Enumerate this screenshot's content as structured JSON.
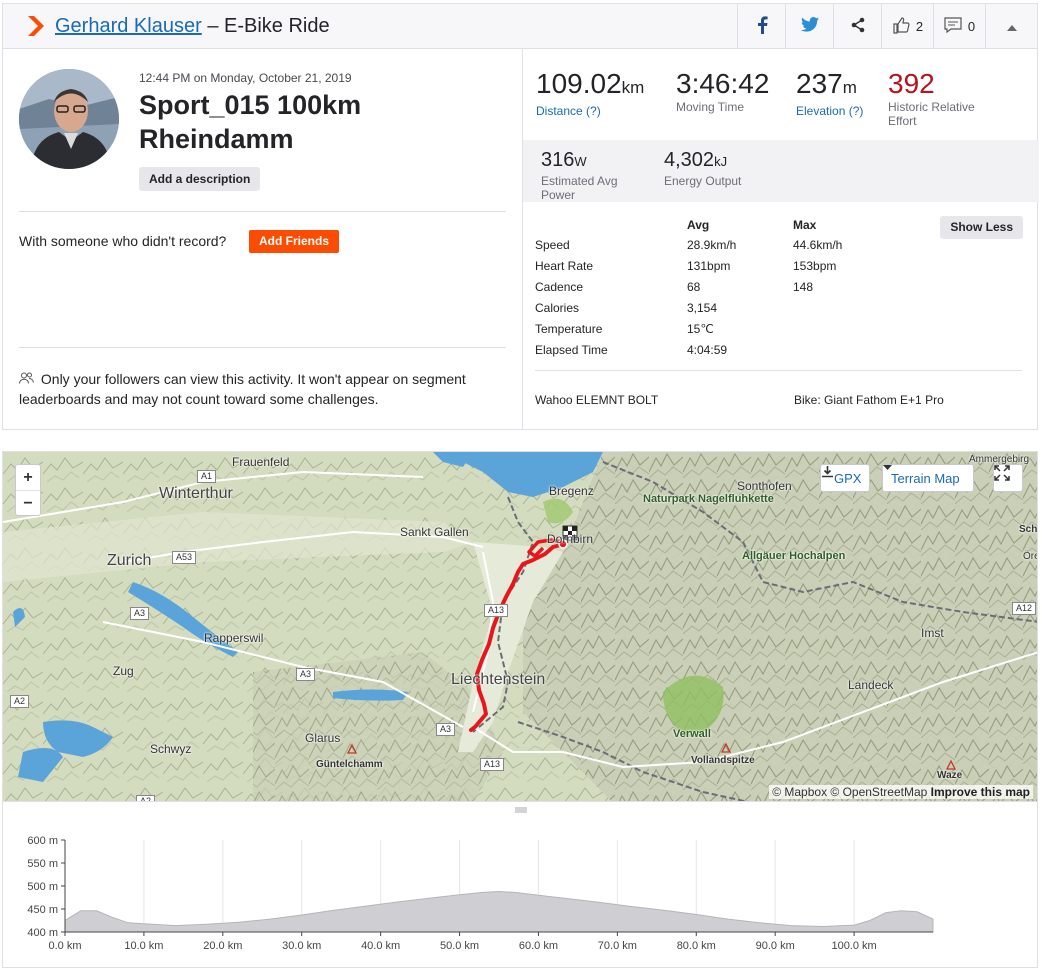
{
  "header": {
    "athlete_name": "Gerhard Klauser",
    "activity_type": "– E-Bike Ride",
    "kudos_count": "2",
    "comments_count": "0",
    "icons": [
      "strava-chevron-icon",
      "facebook-icon",
      "twitter-icon",
      "share-icon",
      "thumbs-up-icon",
      "comment-icon",
      "collapse-caret-icon"
    ]
  },
  "activity": {
    "timestamp": "12:44 PM on Monday, October 21, 2019",
    "name": "Sport_015 100km Rheindamm",
    "add_description": "Add a description",
    "with_someone": "With someone who didn't record?",
    "add_friends": "Add Friends",
    "privacy_text": "Only your followers can view this activity. It won't appear on segment leaderboards and may not count toward some challenges."
  },
  "stats": {
    "distance": {
      "value": "109.02",
      "unit": "km",
      "label": "Distance (?)"
    },
    "moving_time": {
      "value": "3:46:42",
      "label": "Moving Time"
    },
    "elevation": {
      "value": "237",
      "unit": "m",
      "label": "Elevation (?)"
    },
    "relative_effort": {
      "value": "392",
      "label": "Historic Relative Effort"
    },
    "power": {
      "value": "316",
      "unit": "W",
      "label": "Estimated Avg Power"
    },
    "energy": {
      "value": "4,302",
      "unit": "kJ",
      "label": "Energy Output"
    }
  },
  "metrics": {
    "col_avg": "Avg",
    "col_max": "Max",
    "show_less": "Show Less",
    "rows": [
      {
        "label": "Speed",
        "avg": "28.9km/h",
        "max": "44.6km/h"
      },
      {
        "label": "Heart Rate",
        "avg": "131bpm",
        "max": "153bpm"
      },
      {
        "label": "Cadence",
        "avg": "68",
        "max": "148"
      },
      {
        "label": "Calories",
        "avg": "3,154",
        "max": ""
      },
      {
        "label": "Temperature",
        "avg": "15℃",
        "max": ""
      },
      {
        "label": "Elapsed Time",
        "avg": "4:04:59",
        "max": ""
      }
    ],
    "device": "Wahoo ELEMNT BOLT",
    "bike": "Bike: Giant Fathom E+1 Pro"
  },
  "map": {
    "zoom_in": "+",
    "zoom_out": "−",
    "gpx": "GPX",
    "map_type": "Terrain Map",
    "attribution_prefix": "© Mapbox © OpenStreetMap",
    "attribution_link": "Improve this map",
    "labels": {
      "frauenfeld": "Frauenfeld",
      "winterthur": "Winterthur",
      "zurich": "Zurich",
      "rapperswil": "Rapperswil",
      "zug": "Zug",
      "schwyz": "Schwyz",
      "glarus": "Glarus",
      "guntelchamm": "Güntelchamm",
      "sankt_gallen": "Sankt Gallen",
      "bregenz": "Bregenz",
      "dornbirn": "Dornbirn",
      "liechtenstein": "Liechtenstein",
      "sonthofen": "Sonthofen",
      "nagelfluhkette": "Naturpark Nagelfluhkette",
      "hochalpen": "Allgäuer Hochalpen",
      "imst": "Imst",
      "landeck": "Landeck",
      "verwall": "Verwall",
      "vollandspitze": "Vollandspitze",
      "waze": "Waze",
      "ammergebirge": "Ammergebirg",
      "sch": "Sch",
      "oro": "Öre"
    },
    "shields": {
      "a1": "A1",
      "a53": "A53",
      "a3a": "A3",
      "a3b": "A3",
      "a2": "A2",
      "a13a": "A13",
      "a13b": "A13",
      "a3c": "A3",
      "a12": "A12",
      "a2b": "A2"
    },
    "colors": {
      "route": "#e8161c",
      "water": "#5aa4d9",
      "terrain": "#cfd8b8"
    }
  },
  "chart_data": {
    "type": "area",
    "title": "",
    "xlabel": "",
    "ylabel": "",
    "ylim": [
      400,
      600
    ],
    "xlim": [
      0,
      110
    ],
    "y_ticks": [
      "600 m",
      "550 m",
      "500 m",
      "450 m",
      "400 m"
    ],
    "x_ticks": [
      "0.0 km",
      "10.0 km",
      "20.0 km",
      "30.0 km",
      "40.0 km",
      "50.0 km",
      "60.0 km",
      "70.0 km",
      "80.0 km",
      "90.0 km",
      "100.0 km"
    ],
    "series": [
      {
        "x": [
          0,
          2,
          4,
          6,
          8,
          10,
          14,
          18,
          22,
          26,
          30,
          34,
          38,
          42,
          46,
          50,
          53,
          55,
          57,
          60,
          64,
          68,
          72,
          76,
          80,
          84,
          88,
          92,
          96,
          100,
          102,
          104,
          106,
          108,
          110
        ],
        "values": [
          425,
          446,
          446,
          432,
          420,
          418,
          414,
          417,
          421,
          428,
          437,
          447,
          456,
          465,
          473,
          481,
          486,
          488,
          486,
          480,
          472,
          464,
          455,
          447,
          438,
          428,
          420,
          414,
          412,
          415,
          425,
          442,
          446,
          444,
          428
        ]
      }
    ]
  }
}
